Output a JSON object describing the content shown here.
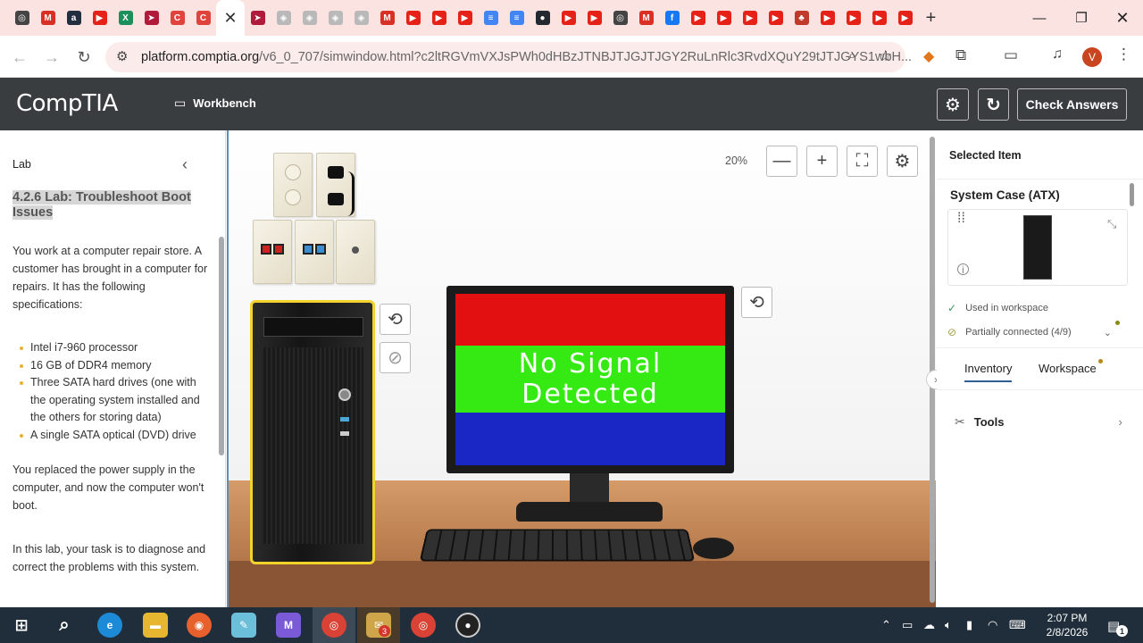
{
  "browser": {
    "tabs": [
      {
        "icon": "chatgpt-icon",
        "color": "#444444",
        "glyph": "◎"
      },
      {
        "icon": "gmail-icon",
        "color": "#d93025",
        "glyph": "M"
      },
      {
        "icon": "amazon-icon",
        "color": "#232f3e",
        "glyph": "a"
      },
      {
        "icon": "youtube-icon",
        "color": "#e62117",
        "glyph": "▶"
      },
      {
        "icon": "excel-icon",
        "color": "#1d8f5a",
        "glyph": "X"
      },
      {
        "icon": "bookmark-icon",
        "color": "#b11b3b",
        "glyph": "➤"
      },
      {
        "icon": "c-icon",
        "color": "#e0433b",
        "glyph": "C"
      },
      {
        "icon": "c-icon",
        "color": "#e0433b",
        "glyph": "C"
      }
    ],
    "tabs_after": [
      {
        "icon": "bookmark-icon",
        "color": "#b11b3b",
        "glyph": "➤"
      },
      {
        "icon": "generic-icon",
        "color": "#b9b9b9",
        "glyph": "◈"
      },
      {
        "icon": "generic-icon",
        "color": "#b9b9b9",
        "glyph": "◈"
      },
      {
        "icon": "generic-icon",
        "color": "#b9b9b9",
        "glyph": "◈"
      },
      {
        "icon": "generic-icon",
        "color": "#b9b9b9",
        "glyph": "◈"
      },
      {
        "icon": "gmail-icon",
        "color": "#d93025",
        "glyph": "M"
      },
      {
        "icon": "youtube-icon",
        "color": "#e62117",
        "glyph": "▶"
      },
      {
        "icon": "youtube-icon",
        "color": "#e62117",
        "glyph": "▶"
      },
      {
        "icon": "youtube-icon",
        "color": "#e62117",
        "glyph": "▶"
      },
      {
        "icon": "docs-icon",
        "color": "#4285f4",
        "glyph": "≡"
      },
      {
        "icon": "docs-icon",
        "color": "#4285f4",
        "glyph": "≡"
      },
      {
        "icon": "github-icon",
        "color": "#24292f",
        "glyph": "●"
      },
      {
        "icon": "youtube-icon",
        "color": "#e62117",
        "glyph": "▶"
      },
      {
        "icon": "youtube-icon",
        "color": "#e62117",
        "glyph": "▶"
      },
      {
        "icon": "chatgpt-icon",
        "color": "#444444",
        "glyph": "◎"
      },
      {
        "icon": "gmail-icon",
        "color": "#d93025",
        "glyph": "M"
      },
      {
        "icon": "facebook-icon",
        "color": "#1877f2",
        "glyph": "f"
      },
      {
        "icon": "youtube-icon",
        "color": "#e62117",
        "glyph": "▶"
      },
      {
        "icon": "youtube-icon",
        "color": "#e62117",
        "glyph": "▶"
      },
      {
        "icon": "youtube-icon",
        "color": "#e62117",
        "glyph": "▶"
      },
      {
        "icon": "youtube-icon",
        "color": "#e62117",
        "glyph": "▶"
      },
      {
        "icon": "app-icon",
        "color": "#c0392b",
        "glyph": "♣"
      },
      {
        "icon": "youtube-icon",
        "color": "#e62117",
        "glyph": "▶"
      },
      {
        "icon": "youtube-icon",
        "color": "#e62117",
        "glyph": "▶"
      },
      {
        "icon": "youtube-icon",
        "color": "#e62117",
        "glyph": "▶"
      },
      {
        "icon": "youtube-icon",
        "color": "#e62117",
        "glyph": "▶"
      }
    ],
    "new_tab": "+",
    "url_host": "platform.comptia.org",
    "url_path": "/v6_0_707/simwindow.html?c2ltRGVmVXJsPWh0dHBzJTNBJTJGJTJGY2RuLnRlc3RvdXQuY29tJTJGYS1wbH...",
    "profile_initial": "V"
  },
  "app": {
    "logo": "CompTIA",
    "workbench_label": "Workbench",
    "check_answers": "Check Answers"
  },
  "lab": {
    "label": "Lab",
    "title": "4.2.6 Lab: Troubleshoot Boot Issues",
    "intro": "You work at a computer repair store. A customer has brought in a computer for repairs. It has the following specifications:",
    "specs": [
      "Intel i7-960 processor",
      "16 GB of DDR4 memory",
      "Three SATA hard drives (one with the operating system installed and the others for storing data)",
      "A single SATA optical (DVD) drive"
    ],
    "para2": "You replaced the power supply in the computer, and now the computer won't boot.",
    "para3": "In this lab, your task is to diagnose and correct the problems with this system."
  },
  "workspace": {
    "zoom": "20%",
    "monitor_text": "No Signal Detected"
  },
  "selected": {
    "header": "Selected Item",
    "name": "System Case (ATX)",
    "used": "Used in workspace",
    "partial": "Partially connected (4/9)",
    "tab_inventory": "Inventory",
    "tab_workspace": "Workspace",
    "tools": "Tools"
  },
  "taskbar": {
    "time": "2:07 PM",
    "date": "2/8/2026",
    "mail_badge": "3",
    "notif_badge": "1"
  }
}
